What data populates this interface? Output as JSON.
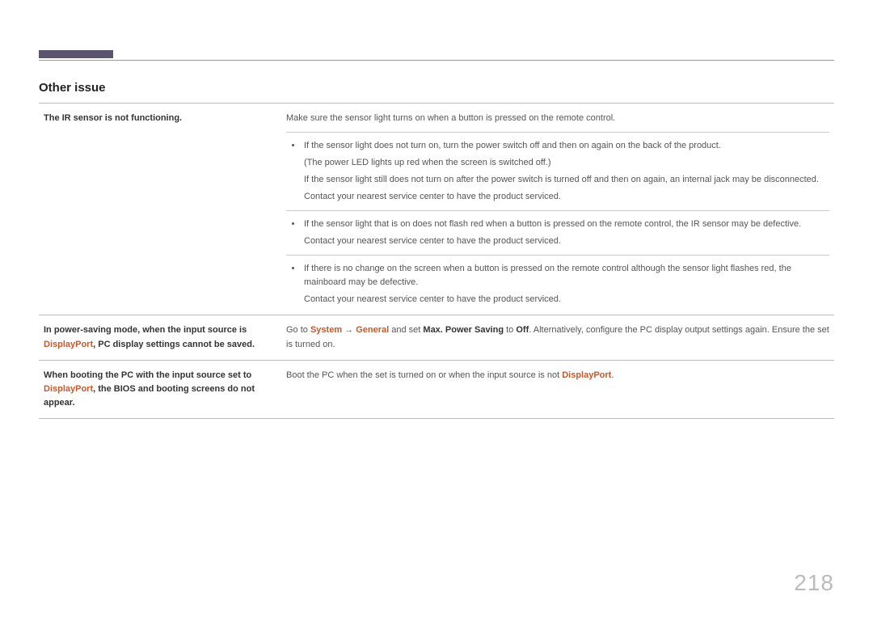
{
  "page_number": "218",
  "section_title": "Other issue",
  "rows": [
    {
      "label_parts": [
        {
          "t": "The IR sensor is not functioning.",
          "b": true
        }
      ],
      "lead": "Make sure the sensor light turns on when a button is pressed on the remote control.",
      "bullets": [
        [
          "If the sensor light does not turn on, turn the power switch off and then on again on the back of the product.",
          "(The power LED lights up red when the screen is switched off.)",
          "If the sensor light still does not turn on after the power switch is turned off and then on again, an internal jack may be disconnected.",
          "Contact your nearest service center to have the product serviced."
        ],
        [
          "If the sensor light that is on does not flash red when a button is pressed on the remote control, the IR sensor may be defective.",
          "Contact your nearest service center to have the product serviced."
        ],
        [
          "If there is no change on the screen when a button is pressed on the remote control although the sensor light flashes red, the mainboard may be defective.",
          "Contact your nearest service center to have the product serviced."
        ]
      ]
    },
    {
      "label_parts": [
        {
          "t": "In power-saving mode, when the input source is ",
          "b": true
        },
        {
          "t": "DisplayPort",
          "hl": true
        },
        {
          "t": ", PC display settings cannot be saved.",
          "b": true
        }
      ],
      "right_rich": [
        {
          "t": "Go to "
        },
        {
          "t": "System",
          "hl": true
        },
        {
          "t": " → "
        },
        {
          "t": "General",
          "hl": true
        },
        {
          "t": " and set "
        },
        {
          "t": "Max. Power Saving",
          "b": true
        },
        {
          "t": " to "
        },
        {
          "t": "Off",
          "b": true
        },
        {
          "t": ". Alternatively, configure the PC display output settings again. Ensure the set is turned on."
        }
      ]
    },
    {
      "label_parts": [
        {
          "t": "When booting the PC with the input source set to ",
          "b": true
        },
        {
          "t": "DisplayPort",
          "hl": true
        },
        {
          "t": ", the BIOS and booting screens do not appear.",
          "b": true
        }
      ],
      "right_rich": [
        {
          "t": "Boot the PC when the set is turned on or when the input source is not "
        },
        {
          "t": "DisplayPort",
          "hl": true
        },
        {
          "t": "."
        }
      ]
    }
  ]
}
